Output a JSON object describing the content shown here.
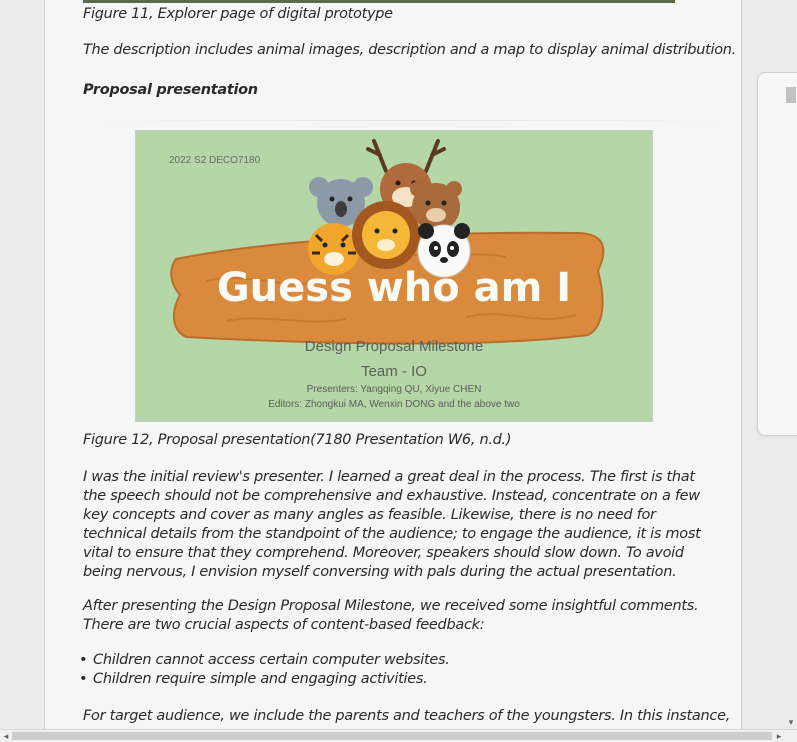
{
  "document": {
    "figure11_caption": "Figure 11, Explorer page of digital prototype",
    "figure11_description": "The description includes animal images, description and a map to display animal distribution.",
    "section_heading": "Proposal presentation",
    "slide": {
      "course_code": "2022 S2 DECO7180",
      "title": "Guess who am I",
      "subtitle": "Design Proposal Milestone",
      "team": "Team - IO",
      "presenters": "Presenters: Yangqing QU, Xiyue CHEN",
      "editors": "Editors: Zhongkui MA, Wenxin DONG and the above two",
      "colors": {
        "background": "#b5d6a7",
        "board": "#d98a3c",
        "text": "#5c5c5c"
      }
    },
    "figure12_caption": "Figure 12, Proposal presentation(7180 Presentation W6, n.d.)",
    "paragraph1": "I was the initial review's presenter. I learned a great deal in the process. The first is that the speech should not be comprehensive and exhaustive. Instead, concentrate on a few key concepts and cover as many angles as feasible. Likewise, there is no need for technical details from the standpoint of the audience; to engage the audience, it is most vital to ensure that they comprehend. Moreover, speakers should slow down. To avoid being nervous, I envision myself conversing with pals during the actual presentation.",
    "paragraph2": "After presenting the Design Proposal Milestone, we received some insightful comments. There are two crucial aspects of content-based feedback:",
    "bullets": [
      "Children cannot access certain computer websites.",
      "Children require simple and engaging activities."
    ],
    "paragraph3": "For target audience, we include the parents and teachers of the youngsters. In this instance,"
  },
  "scrollbars": {
    "left_arrow_icon": "arrow-left-icon",
    "right_arrow_icon": "arrow-right-icon",
    "down_arrow_icon": "arrow-down-icon",
    "left_glyph": "◂",
    "right_glyph": "▸",
    "down_glyph": "▾"
  }
}
